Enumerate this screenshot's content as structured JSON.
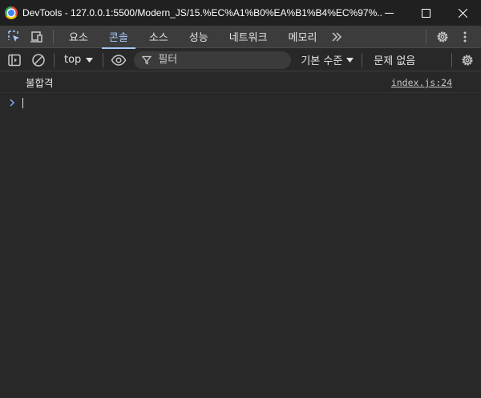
{
  "window": {
    "title": "DevTools - 127.0.0.1:5500/Modern_JS/15.%EC%A1%B0%EA%B1%B4%EC%97%..."
  },
  "tabs": [
    {
      "label": "요소",
      "active": false
    },
    {
      "label": "콘솔",
      "active": true
    },
    {
      "label": "소스",
      "active": false
    },
    {
      "label": "성능",
      "active": false
    },
    {
      "label": "네트워크",
      "active": false
    },
    {
      "label": "메모리",
      "active": false
    }
  ],
  "toolbar": {
    "context": "top",
    "filter_placeholder": "필터",
    "levels": "기본 수준",
    "issues": "문제 없음"
  },
  "console": {
    "messages": [
      {
        "text": "불합격",
        "source": "index.js:24"
      }
    ]
  },
  "colors": {
    "accent": "#a8c7fa",
    "background": "#282828",
    "titlebar": "#202020",
    "tabbar": "#3c3c3c"
  }
}
